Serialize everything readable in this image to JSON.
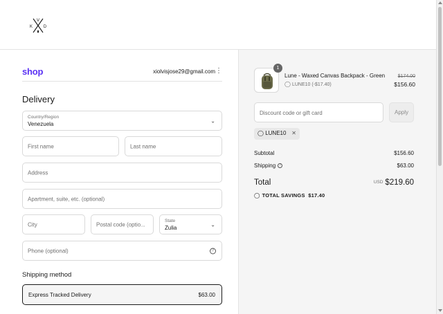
{
  "brand": {
    "logo_letters": [
      "V",
      "K",
      "D"
    ]
  },
  "shop_pay": {
    "logo_text": "shop",
    "account_email": "xiolvisjose29@gmail.com",
    "menu_glyph": "⋮"
  },
  "delivery": {
    "heading": "Delivery",
    "country": {
      "label": "Country/Region",
      "value": "Venezuela"
    },
    "first_name": {
      "placeholder": "First name",
      "value": ""
    },
    "last_name": {
      "placeholder": "Last name",
      "value": ""
    },
    "address": {
      "placeholder": "Address",
      "value": ""
    },
    "apartment": {
      "placeholder": "Apartment, suite, etc. (optional)",
      "value": ""
    },
    "city": {
      "placeholder": "City",
      "value": ""
    },
    "postal_code": {
      "placeholder": "Postal code (optio...",
      "value": ""
    },
    "state": {
      "label": "State",
      "value": "Zulia"
    },
    "phone": {
      "placeholder": "Phone (optional)",
      "value": "",
      "help_glyph": "?"
    }
  },
  "shipping": {
    "heading": "Shipping method",
    "selected": {
      "name": "Express Tracked Delivery",
      "price": "$63.00"
    }
  },
  "order": {
    "item": {
      "quantity": "1",
      "name": "Lune - Waxed Canvas Backpack - Green",
      "discount_line": "LUNE10 (-$17.40)",
      "original_price": "$174.00",
      "price": "$156.60"
    },
    "discount_input": {
      "placeholder": "Discount code or gift card"
    },
    "apply_label": "Apply",
    "applied_code": "LUNE10",
    "remove_glyph": "✕",
    "subtotal": {
      "label": "Subtotal",
      "value": "$156.60"
    },
    "shipping": {
      "label": "Shipping",
      "value": "$63.00",
      "info_glyph": "?"
    },
    "total": {
      "label": "Total",
      "currency": "USD",
      "value": "$219.60"
    },
    "savings": {
      "label": "TOTAL SAVINGS",
      "value": "$17.40"
    }
  },
  "colors": {
    "shop_purple": "#5a31f4",
    "summary_bg": "#f5f5f5",
    "border": "#d9d9d9"
  },
  "icons": [
    "brand-logo",
    "chevron-down-icon",
    "help-icon",
    "tag-icon",
    "close-icon",
    "info-icon",
    "backpack-thumbnail"
  ]
}
